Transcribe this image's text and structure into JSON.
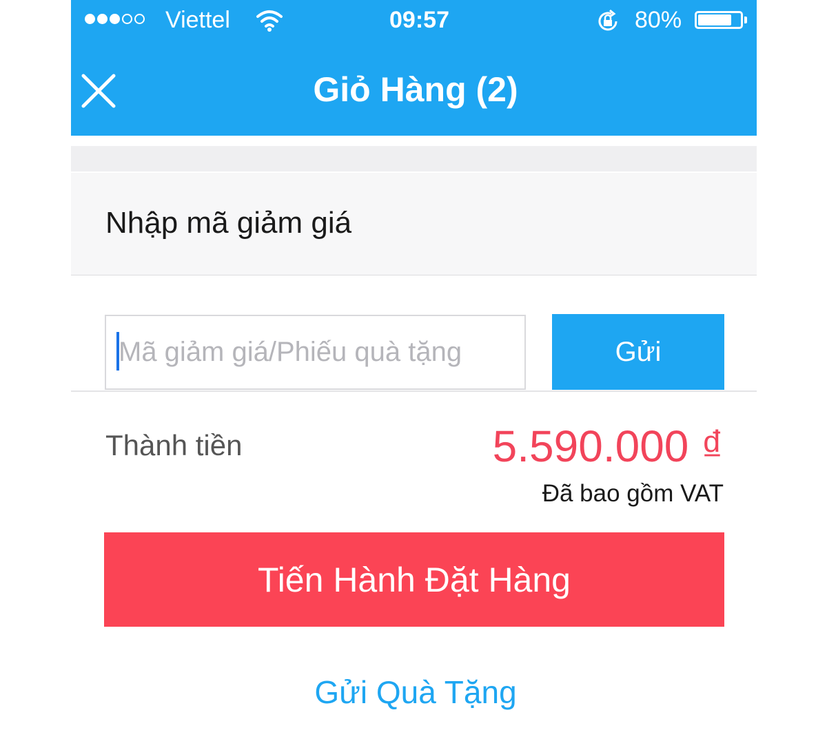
{
  "status_bar": {
    "carrier": "Viettel",
    "time": "09:57",
    "battery_percent": "80%",
    "battery_level": 0.8,
    "signal_bars_filled": 3,
    "signal_bars_total": 5,
    "icons": [
      "signal-dots-icon",
      "wifi-icon",
      "rotation-lock-icon",
      "battery-icon"
    ]
  },
  "header": {
    "title": "Giỏ Hàng (2)",
    "close_icon": "close-icon",
    "background_color": "#1ea6f2"
  },
  "discount": {
    "section_title": "Nhập mã giảm giá",
    "input_placeholder": "Mã giảm giá/Phiếu quà tặng",
    "input_value": "",
    "submit_label": "Gửi"
  },
  "summary": {
    "total_label": "Thành tiền",
    "total_value": "5.590.000 ₫",
    "vat_note": "Đã bao gồm VAT",
    "price_color": "#f2445a"
  },
  "actions": {
    "checkout_label": "Tiến Hành Đặt Hàng",
    "checkout_color": "#fb4455",
    "gift_label": "Gửi Quà Tặng",
    "gift_color": "#1ea6f2"
  }
}
